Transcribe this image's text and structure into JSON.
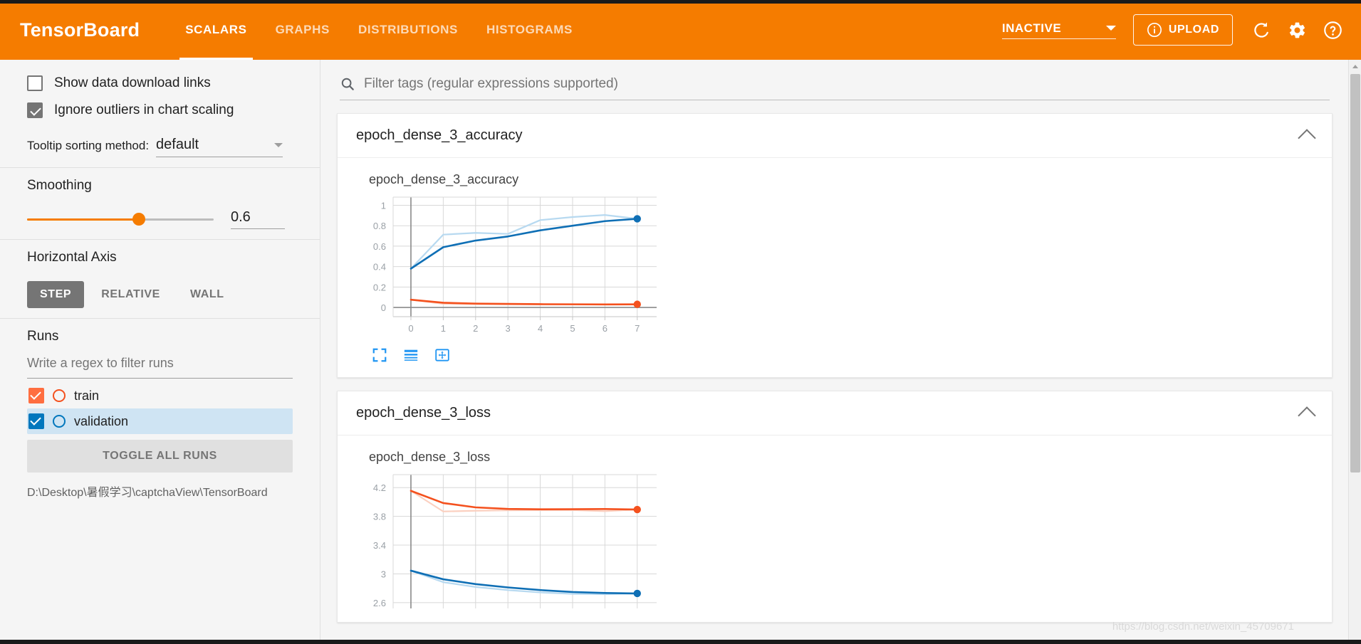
{
  "header": {
    "brand": "TensorBoard",
    "tabs": [
      {
        "label": "SCALARS",
        "active": true
      },
      {
        "label": "GRAPHS",
        "active": false
      },
      {
        "label": "DISTRIBUTIONS",
        "active": false
      },
      {
        "label": "HISTOGRAMS",
        "active": false
      }
    ],
    "mode_selected": "INACTIVE",
    "upload_label": "UPLOAD",
    "icons": [
      "info-icon",
      "refresh-icon",
      "gear-icon",
      "help-icon"
    ],
    "accent_color": "#f57c00"
  },
  "sidebar": {
    "show_download_links": {
      "label": "Show data download links",
      "checked": false
    },
    "ignore_outliers": {
      "label": "Ignore outliers in chart scaling",
      "checked": true
    },
    "tooltip_sorting": {
      "label": "Tooltip sorting method:",
      "value": "default"
    },
    "smoothing": {
      "title": "Smoothing",
      "value": "0.6",
      "fraction": 60
    },
    "horizontal_axis": {
      "title": "Horizontal Axis",
      "options": [
        {
          "label": "STEP",
          "active": true
        },
        {
          "label": "RELATIVE",
          "active": false
        },
        {
          "label": "WALL",
          "active": false
        }
      ]
    },
    "runs": {
      "title": "Runs",
      "filter_placeholder": "Write a regex to filter runs",
      "filter_value": "",
      "items": [
        {
          "name": "train",
          "checked": true,
          "color": "#ff6e40",
          "highlighted": false
        },
        {
          "name": "validation",
          "checked": true,
          "color": "#0277bd",
          "highlighted": true
        }
      ],
      "toggle_all_label": "TOGGLE ALL RUNS",
      "logdir": "D:\\Desktop\\暑假学习\\captchaView\\TensorBoard"
    }
  },
  "main": {
    "search": {
      "placeholder": "Filter tags (regular expressions supported)",
      "value": "",
      "icon": "search-icon"
    },
    "cards": [
      {
        "title": "epoch_dense_3_accuracy",
        "expanded": true
      },
      {
        "title": "epoch_dense_3_loss",
        "expanded": true
      }
    ],
    "chart_tool_icons": [
      "expand-chart-icon",
      "toggle-y-axis-icon",
      "fit-domain-icon"
    ],
    "watermark": "https://blog.csdn.net/weixin_45709671"
  },
  "chart_data": [
    {
      "type": "line",
      "title": "epoch_dense_3_accuracy",
      "xlabel": "",
      "ylabel": "",
      "x": [
        0,
        1,
        2,
        3,
        4,
        5,
        6,
        7
      ],
      "xticks": [
        "0",
        "1",
        "2",
        "3",
        "4",
        "5",
        "6",
        "7"
      ],
      "yticks": [
        "0",
        "0.2",
        "0.4",
        "0.6",
        "0.8",
        "1"
      ],
      "xlim": [
        -0.55,
        7.6
      ],
      "ylim": [
        -0.09,
        1.08
      ],
      "grid": true,
      "legend": "none",
      "series": [
        {
          "name": "validation",
          "color": "#0f6fb5",
          "smoothed": true,
          "values": [
            0.38,
            0.59,
            0.655,
            0.695,
            0.755,
            0.8,
            0.845,
            0.868
          ],
          "endpoint_marker": true
        },
        {
          "name": "validation_raw",
          "color": "#b7d9f0",
          "smoothed": false,
          "values": [
            0.38,
            0.713,
            0.73,
            0.72,
            0.855,
            0.885,
            0.905,
            0.868
          ],
          "endpoint_marker": false
        },
        {
          "name": "train",
          "color": "#f4511e",
          "smoothed": true,
          "values": [
            0.076,
            0.046,
            0.038,
            0.035,
            0.032,
            0.031,
            0.03,
            0.031
          ],
          "endpoint_marker": true
        },
        {
          "name": "train_raw",
          "color": "#fbd0c0",
          "smoothed": false,
          "values": [
            0.076,
            0.035,
            0.032,
            0.031,
            0.03,
            0.029,
            0.029,
            0.031
          ],
          "endpoint_marker": false
        }
      ]
    },
    {
      "type": "line",
      "title": "epoch_dense_3_loss",
      "xlabel": "",
      "ylabel": "",
      "x": [
        0,
        1,
        2,
        3,
        4,
        5,
        6,
        7
      ],
      "xticks": [],
      "yticks": [
        "2.6",
        "3",
        "3.4",
        "3.8",
        "4.2"
      ],
      "xlim": [
        -0.55,
        7.6
      ],
      "ylim": [
        2.52,
        4.38
      ],
      "grid": true,
      "legend": "none",
      "series": [
        {
          "name": "train",
          "color": "#f4511e",
          "smoothed": true,
          "values": [
            4.155,
            3.985,
            3.925,
            3.903,
            3.898,
            3.9,
            3.902,
            3.895
          ],
          "endpoint_marker": true
        },
        {
          "name": "train_raw",
          "color": "#fbd0c0",
          "smoothed": false,
          "values": [
            4.155,
            3.868,
            3.878,
            3.884,
            3.886,
            3.888,
            3.872,
            3.895
          ],
          "endpoint_marker": false
        },
        {
          "name": "validation",
          "color": "#0f6fb5",
          "smoothed": true,
          "values": [
            3.045,
            2.925,
            2.858,
            2.812,
            2.775,
            2.748,
            2.735,
            2.728
          ],
          "endpoint_marker": true
        },
        {
          "name": "validation_raw",
          "color": "#b7d9f0",
          "smoothed": false,
          "values": [
            3.045,
            2.885,
            2.818,
            2.775,
            2.742,
            2.722,
            2.718,
            2.728
          ],
          "endpoint_marker": false
        }
      ]
    }
  ]
}
